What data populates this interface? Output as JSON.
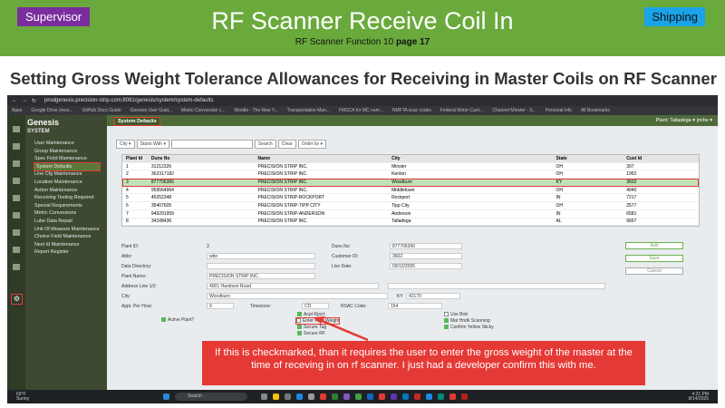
{
  "banner": {
    "badge_left": "Supervisor",
    "badge_right": "Shipping",
    "title": "RF Scanner Receive Coil In",
    "subtitle_pre": "RF Scanner Function 10 ",
    "subtitle_page": "page 17"
  },
  "heading": "Setting Gross Weight Tolerance Allowances for Receiving in Master Coils on RF Scanner",
  "browser": {
    "url": "prodgenesis.precision-strip.com:8081/genesis/system/system-defaults",
    "bookmarks": [
      "Apps",
      "Google Drive (resn...",
      "GitHub Docs Guide",
      "Genesis User Guid...",
      "Metric Conversion c...",
      "Wordle - The New Y...",
      "Transportation Man...",
      "FMSCA for MC num...",
      "NMFTA scac codes",
      "Federal Motor Carri...",
      "Channel Minster - S...",
      "Personal info",
      "All Bookmarks"
    ]
  },
  "sidebar": {
    "logo": "Genesis",
    "section": "SYSTEM",
    "items": [
      "User Maintenance",
      "Group Maintenance",
      "Spec Field Maintenance",
      "System Defaults",
      "Line Cfg Maintenance",
      "Location Maintenance",
      "Action Maintenance",
      "Receiving Testing Required",
      "Special Requirements",
      "Metric Conversions",
      "Lube Data Repair",
      "Unit Of Measure Maintenance",
      "Choice Field Maintenance",
      "Next Id Maintenance",
      "Report Register"
    ]
  },
  "app": {
    "tab": "System Defaults",
    "plant": "Plant: Talladega ▾",
    "user": "jmihe ▾"
  },
  "toolbar": {
    "city": "City ▾",
    "starts": "Starts With ▾",
    "search": "Search",
    "clear": "Clear",
    "order": "Order by ▾"
  },
  "grid": {
    "headers": [
      "Plant Id",
      "Duns No",
      "Name",
      "City",
      "State",
      "Cust Id"
    ],
    "rows": [
      [
        "1",
        "31212326",
        "PRECISION STRIP INC.",
        "Minster",
        "OH",
        "307"
      ],
      [
        "2",
        "362317182",
        "PRECISION STRIP INC.",
        "Kenton",
        "OH",
        "1952"
      ],
      [
        "3",
        "877706366",
        "PRECISION STRIP INC.",
        "Woodburn",
        "KY",
        "3602"
      ],
      [
        "4",
        "959564964",
        "PRECISION STRIP INC.",
        "Middletown",
        "OH",
        "4040"
      ],
      [
        "5",
        "45252348",
        "PRECISION STRIP-ROCKPORT",
        "Rockport",
        "IN",
        "7217"
      ],
      [
        "6",
        "35407605",
        "PRECISION STRIP-TIPP CITY",
        "Tipp City",
        "OH",
        "2577"
      ],
      [
        "7",
        "949291959",
        "PRECISION STRIP-ANDERSON",
        "Anderson",
        "IN",
        "6581"
      ],
      [
        "8",
        "34108436",
        "PRECISION STRIP INC.",
        "Talladega",
        "AL",
        "9667"
      ]
    ]
  },
  "form": {
    "plant_id_l": "Plant ID:",
    "plant_id": "3",
    "duns_l": "Duns No:",
    "duns": "877706366",
    "abbr_l": "Abbr:",
    "abbr": "wbn",
    "cust_l": "Customer ID:",
    "cust": "3602",
    "dir_l": "Data Directory:",
    "live_l": "Live Date:",
    "live": "09/12/2005",
    "pname_l": "Plant Name:",
    "pname": "PRECISION STRIP INC.",
    "addr_l": "Address Line 1/2:",
    "addr": "4001 Hardison Road",
    "city_l": "City:",
    "city": "Woodburn",
    "state": "KY",
    "zip": "42170",
    "pph_l": "Appt. Per Hour:",
    "pph": "9",
    "tz_l": "Timezone:",
    "tz": "CD",
    "rsac_l": "RSAC Code:",
    "rsac": "154",
    "active": "Active Plant?",
    "cb1": "Acpt Rpcrt",
    "cb2": "Enter Rcpt Weight",
    "cb3": "Secure Tag",
    "cb4": "Secure RF",
    "cb5": "Use Bob",
    "cb6": "Mat Hndk Scanning",
    "cb7": "Confirm Yellow Sticky",
    "add": "Add",
    "save": "Save",
    "cancel": "Cancel"
  },
  "callout": "If this is checkmarked, than it requires the user to enter the gross weight of the master at the time of receving in on rf scanner. I just had a developer confirm this with me.",
  "taskbar": {
    "temp": "69°F",
    "cond": "Sunny",
    "search": "Search",
    "time": "4:21 PM",
    "date": "8/14/2025"
  }
}
